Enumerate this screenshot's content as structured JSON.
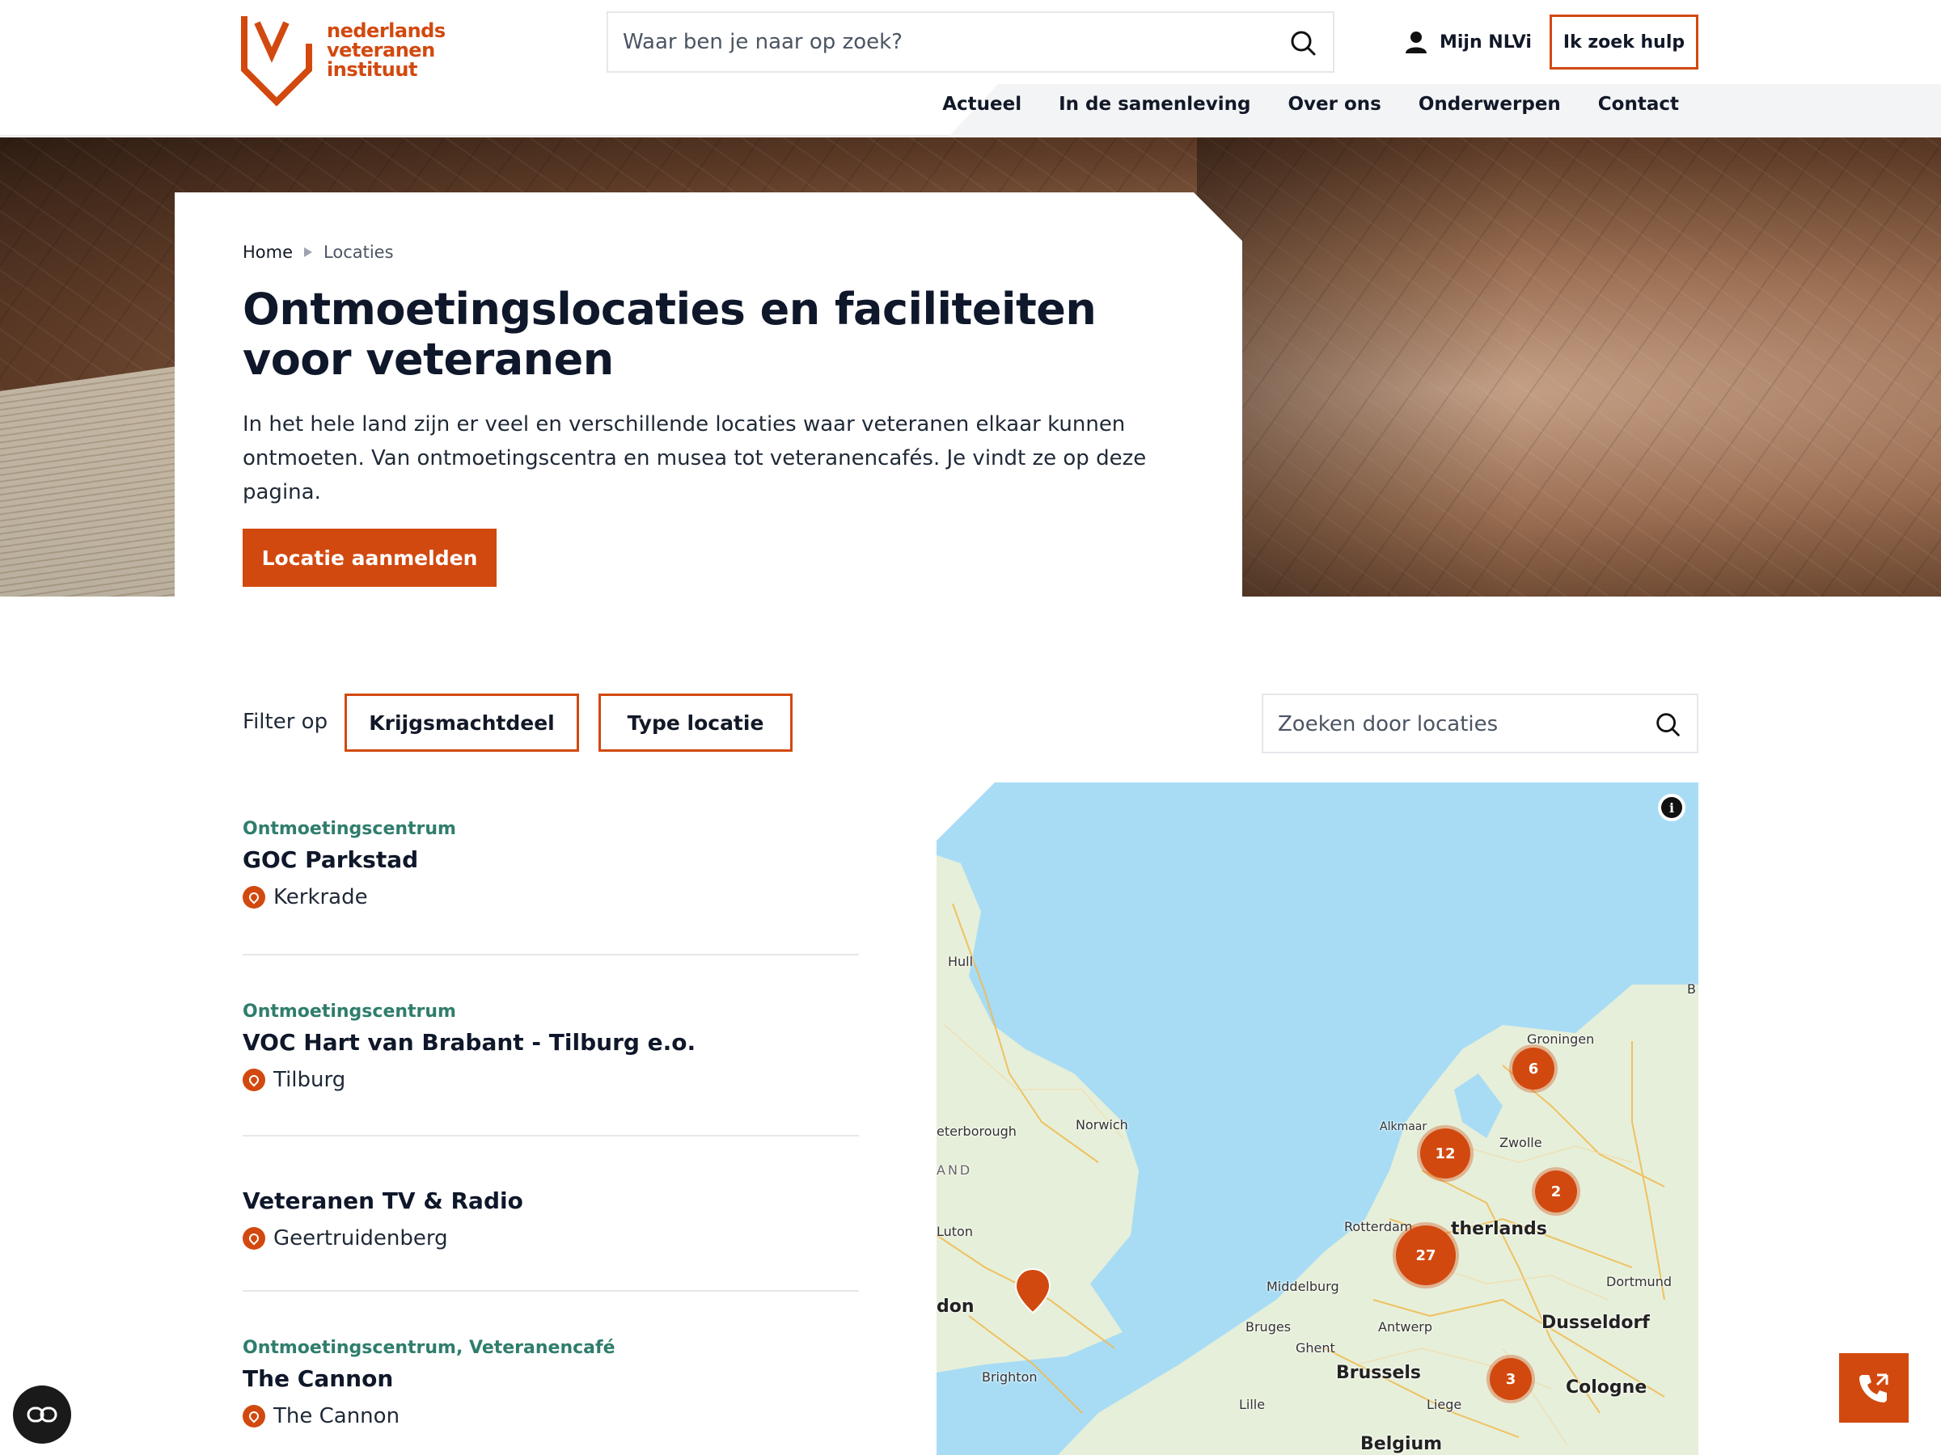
{
  "header": {
    "logo": {
      "line1": "nederlands",
      "line2": "veteranen",
      "line3": "instituut"
    },
    "search_placeholder": "Waar ben je naar op zoek?",
    "account_label": "Mijn NLVi",
    "help_button": "Ik zoek hulp",
    "nav": [
      "Actueel",
      "In de samenleving",
      "Over ons",
      "Onderwerpen",
      "Contact"
    ]
  },
  "hero": {
    "breadcrumb": {
      "home": "Home",
      "current": "Locaties"
    },
    "title": "Ontmoetingslocaties en faciliteiten voor veteranen",
    "intro": "In het hele land zijn er veel en verschillende locaties waar veteranen elkaar kunnen ontmoeten. Van ontmoetingscentra en musea tot veteranencafés. Je vindt ze op deze pagina.",
    "cta": "Locatie aanmelden"
  },
  "filters": {
    "label": "Filter op",
    "buttons": [
      "Krijgsmachtdeel",
      "Type locatie"
    ],
    "search_placeholder": "Zoeken door locaties"
  },
  "locations": [
    {
      "category": "Ontmoetingscentrum",
      "name": "GOC Parkstad",
      "place": "Kerkrade"
    },
    {
      "category": "Ontmoetingscentrum",
      "name": "VOC Hart van Brabant - Tilburg e.o.",
      "place": "Tilburg"
    },
    {
      "category": "",
      "name": "Veteranen TV & Radio",
      "place": "Geertruidenberg"
    },
    {
      "category": "Ontmoetingscentrum, Veteranencafé",
      "name": "The Cannon",
      "place": "The Cannon"
    }
  ],
  "map": {
    "clusters": [
      "6",
      "12",
      "2",
      "27",
      "3"
    ],
    "labels": [
      "Hull",
      "Groningen",
      "Alkmaar",
      "Zwolle",
      "eterborough",
      "Norwich",
      "AND",
      "Luton",
      "Rotterdam",
      "therlands",
      "Dortmund",
      "Middelburg",
      "don",
      "Bruges",
      "Ghent",
      "Antwerp",
      "Dusseldorf",
      "Brighton",
      "Brussels",
      "Lille",
      "Liege",
      "Cologne",
      "Belgium",
      "B"
    ],
    "info_icon": "i"
  },
  "colors": {
    "accent": "#d2490f",
    "category": "#2f7d6d",
    "map_water": "#a8dcf5",
    "map_land": "#e6efd9"
  }
}
